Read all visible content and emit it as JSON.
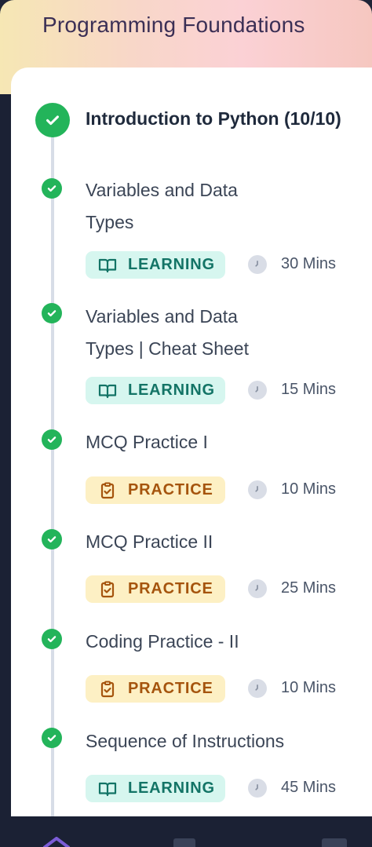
{
  "course": {
    "title": "Programming Foundations"
  },
  "module": {
    "title": "Introduction to Python (10/10)",
    "completed": true
  },
  "items": [
    {
      "title": "Variables and Data Types",
      "type": "LEARNING",
      "duration": "30 Mins",
      "completed": true
    },
    {
      "title": "Variables and Data Types | Cheat Sheet",
      "type": "LEARNING",
      "duration": "15 Mins",
      "completed": true
    },
    {
      "title": "MCQ Practice I",
      "type": "PRACTICE",
      "duration": "10 Mins",
      "completed": true
    },
    {
      "title": "MCQ Practice II",
      "type": "PRACTICE",
      "duration": "25 Mins",
      "completed": true
    },
    {
      "title": "Coding Practice - II",
      "type": "PRACTICE",
      "duration": "10 Mins",
      "completed": true
    },
    {
      "title": "Sequence of Instructions",
      "type": "LEARNING",
      "duration": "45 Mins",
      "completed": true
    }
  ],
  "colors": {
    "check_green": "#23b45a",
    "learning_bg": "#d6f6ef",
    "learning_text": "#137466",
    "practice_bg": "#fdf0c4",
    "practice_text": "#a5540d",
    "nav_bg": "#1b2134"
  },
  "icons": {
    "learning": "book-open-icon",
    "practice": "clipboard-check-icon",
    "duration": "clock-icon",
    "status": "check-circle-icon"
  },
  "bottom_nav": {
    "items": [
      {
        "icon": "home-icon",
        "active": true
      },
      {
        "icon": "document-icon",
        "active": false
      },
      {
        "icon": "terminal-icon",
        "active": false
      }
    ]
  }
}
